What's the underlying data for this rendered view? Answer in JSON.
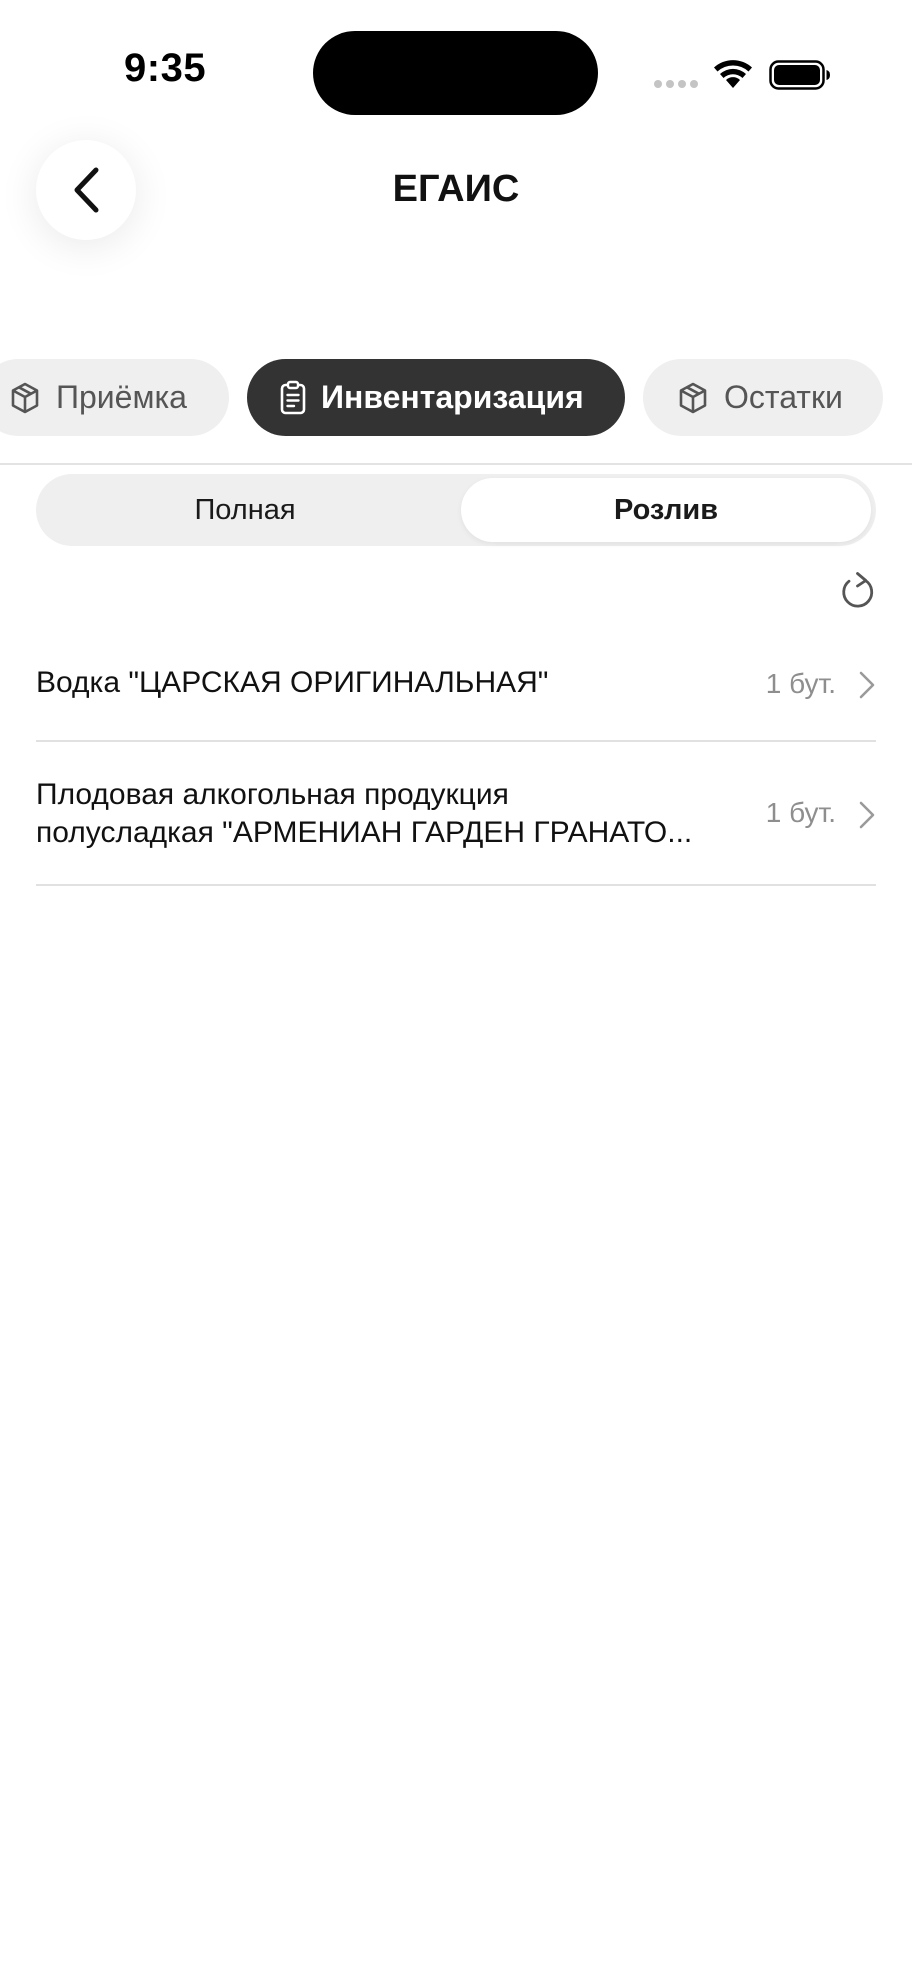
{
  "status_bar": {
    "time": "9:35",
    "icons": [
      "signal-icon",
      "wifi-icon",
      "battery-icon"
    ]
  },
  "header": {
    "title": "ЕГАИС",
    "back_icon": "chevron-left-icon"
  },
  "category_tabs": [
    {
      "label": "Приёмка",
      "icon": "box-icon",
      "selected": false
    },
    {
      "label": "Инвентаризация",
      "icon": "clipboard-icon",
      "selected": true
    },
    {
      "label": "Остатки",
      "icon": "box-icon",
      "selected": false
    }
  ],
  "segmented_control": {
    "options": [
      "Полная",
      "Розлив"
    ],
    "selected": "Розлив"
  },
  "refresh_icon": "refresh-icon",
  "items": [
    {
      "name": "Водка \"ЦАРСКАЯ ОРИГИНАЛЬНАЯ\"",
      "quantity": "1 бут."
    },
    {
      "name_line1": "Плодовая алкогольная продукция",
      "name_line2": "полусладкая \"АРМЕНИАН ГАРДЕН ГРАНАТО...",
      "quantity": "1 бут."
    }
  ],
  "colors": {
    "active_tab_bg": "#333333",
    "inactive_tab_bg": "#efefef",
    "secondary_text": "#8e8e8e"
  }
}
